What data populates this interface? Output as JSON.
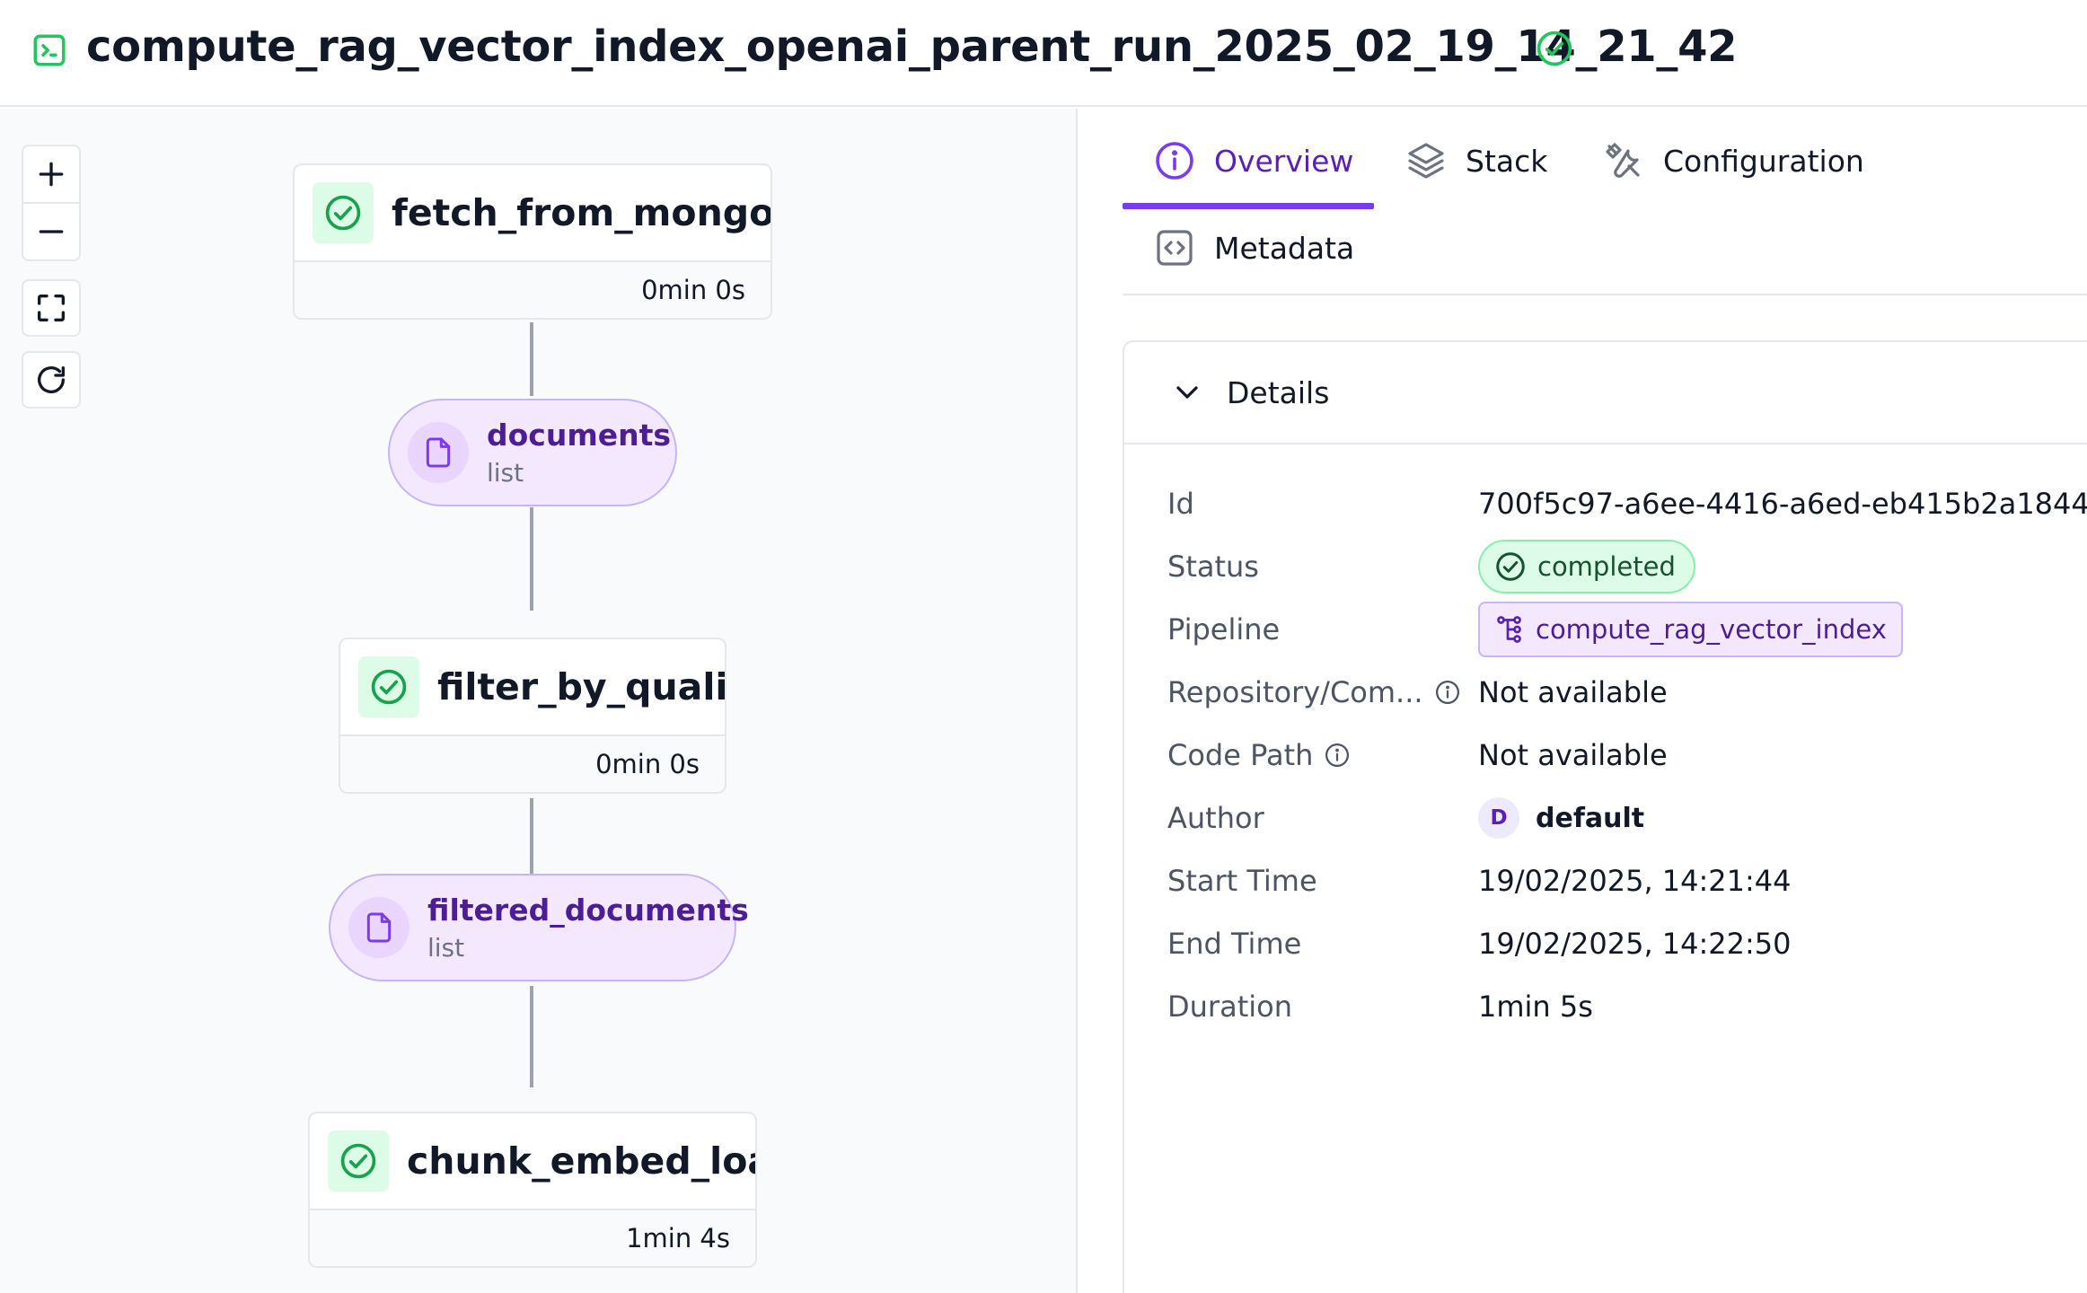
{
  "header": {
    "title": "compute_rag_vector_index_openai_parent_run_2025_02_19_14_21_42",
    "status_icon": "check-circle-icon",
    "run_icon": "terminal-icon",
    "accent_green": "#22c55e"
  },
  "dag": {
    "controls": [
      {
        "name": "zoom-in-button",
        "icon": "plus-icon"
      },
      {
        "name": "zoom-out-button",
        "icon": "minus-icon"
      },
      {
        "name": "fit-view-button",
        "icon": "fullscreen-icon"
      },
      {
        "name": "refresh-button",
        "icon": "refresh-icon"
      }
    ],
    "steps": [
      {
        "name": "fetch_from_mongodb",
        "duration": "0min 0s",
        "status": "completed"
      },
      {
        "name": "filter_by_quality",
        "duration": "0min 0s",
        "status": "completed"
      },
      {
        "name": "chunk_embed_load",
        "duration": "1min 4s",
        "status": "completed"
      }
    ],
    "artifacts": [
      {
        "name": "documents",
        "type": "list"
      },
      {
        "name": "filtered_documents",
        "type": "list"
      }
    ]
  },
  "tabs": [
    {
      "label": "Overview",
      "icon": "info-icon",
      "active": true
    },
    {
      "label": "Stack",
      "icon": "layers-icon",
      "active": false
    },
    {
      "label": "Configuration",
      "icon": "tools-icon",
      "active": false
    },
    {
      "label": "Metadata",
      "icon": "code-brackets-icon",
      "active": false
    }
  ],
  "details": {
    "heading": "Details",
    "rows": {
      "id": {
        "label": "Id",
        "value": "700f5c97-a6ee-4416-a6ed-eb415b2a1844"
      },
      "status": {
        "label": "Status",
        "value": "completed"
      },
      "pipeline": {
        "label": "Pipeline",
        "value": "compute_rag_vector_index"
      },
      "repository": {
        "label": "Repository/Com...",
        "value": "Not available"
      },
      "code_path": {
        "label": "Code Path",
        "value": "Not available"
      },
      "author": {
        "label": "Author",
        "initial": "D",
        "value": "default"
      },
      "start_time": {
        "label": "Start Time",
        "value": "19/02/2025, 14:21:44"
      },
      "end_time": {
        "label": "End Time",
        "value": "19/02/2025, 14:22:50"
      },
      "duration": {
        "label": "Duration",
        "value": "1min 5s"
      }
    }
  },
  "colors": {
    "primary": "#7c3aed",
    "success": "#22c55e",
    "artifact_bg": "#f3e8ff"
  }
}
